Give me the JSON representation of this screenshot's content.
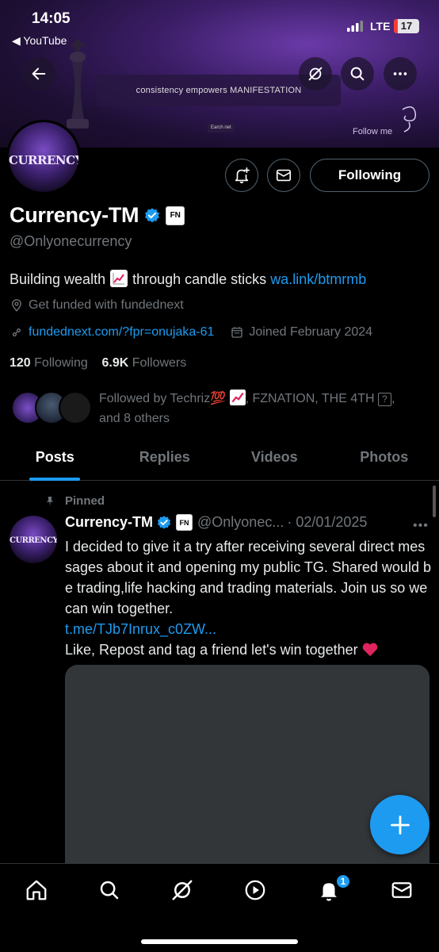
{
  "status_bar": {
    "time": "14:05",
    "back_app": "◀ YouTube",
    "network": "LTE",
    "battery": "17",
    "battery_level": 0.17
  },
  "banner": {
    "quote": "consistency empowers MANIFESTATION",
    "tag": "Earch net",
    "follow_me": "Follow me"
  },
  "avatar": {
    "text": "CURRENCY"
  },
  "actions": {
    "following_label": "Following"
  },
  "profile": {
    "name": "Currency-TM",
    "fn_badge": "FN",
    "handle": "@Onlyonecurrency",
    "bio_before": "Building wealth",
    "bio_after": "through candle sticks",
    "bio_link": "wa.link/btmrmb",
    "location": "Get  funded with fundednext",
    "website": "fundednext.com/?fpr=onujaka-61",
    "joined": "Joined February 2024",
    "following_count": "120",
    "following_label": "Following",
    "followers_count": "6.9K",
    "followers_label": "Followers",
    "followed_by_1": "Followed by Techriz💯",
    "followed_by_2": ", FZNATION, THE 4TH",
    "followed_by_box": "?",
    "followed_by_3": ",",
    "followed_by_others": "and 8 others"
  },
  "tabs": [
    "Posts",
    "Replies",
    "Videos",
    "Photos"
  ],
  "pinned_tweet": {
    "pinned_label": "Pinned",
    "name": "Currency-TM",
    "fn_badge": "FN",
    "handle": "@Onlyonec...",
    "date": "· 02/01/2025",
    "more": "•••",
    "text": "I decided to give it a try after receiving several direct messages about it and opening my public TG. Shared would be trading,life hacking and trading materials. Join us so we can win together.",
    "link": "t.me/TJb7Inrux_c0ZW...",
    "text2": "Like, Repost and tag a friend let's win together"
  },
  "bottom_nav": {
    "notifications_badge": "1"
  },
  "colors": {
    "accent": "#1d9bf0",
    "muted": "#71767b",
    "background": "#000000"
  }
}
